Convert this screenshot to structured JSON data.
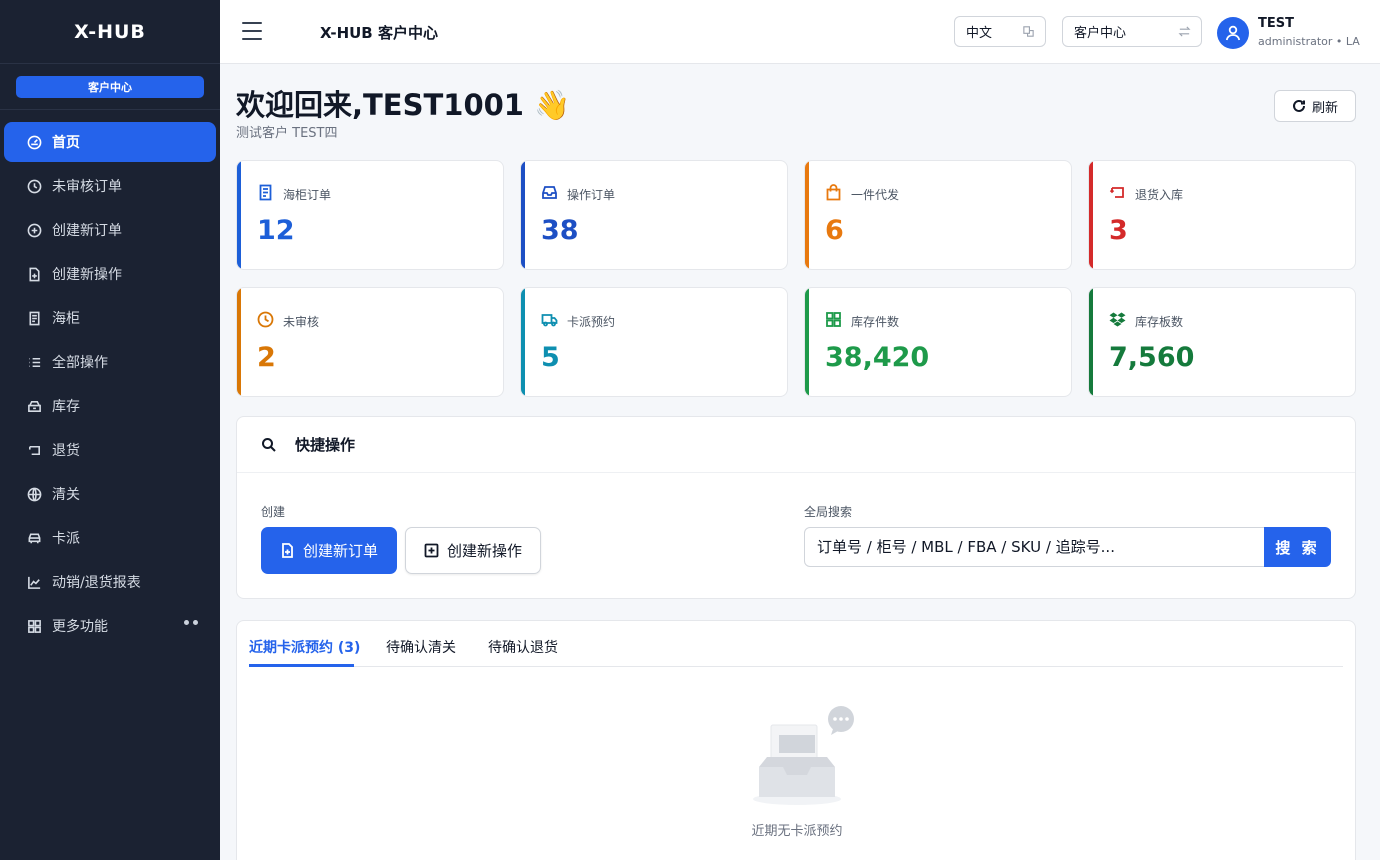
{
  "sidebar": {
    "brand": "X-HUB",
    "badge": "客户中心",
    "items": [
      {
        "label": "首页",
        "icon": "dashboard-icon"
      },
      {
        "label": "未审核订单",
        "icon": "clock-icon"
      },
      {
        "label": "创建新订单",
        "icon": "plus-circle-icon"
      },
      {
        "label": "创建新操作",
        "icon": "file-plus-icon"
      },
      {
        "label": "海柜",
        "icon": "receipt-icon"
      },
      {
        "label": "全部操作",
        "icon": "list-icon"
      },
      {
        "label": "库存",
        "icon": "box-icon"
      },
      {
        "label": "退货",
        "icon": "return-icon"
      },
      {
        "label": "清关",
        "icon": "globe-icon"
      },
      {
        "label": "卡派",
        "icon": "car-icon"
      },
      {
        "label": "动销/退货报表",
        "icon": "chart-icon"
      },
      {
        "label": "更多功能",
        "icon": "grid-icon"
      }
    ]
  },
  "topbar": {
    "title": "X-HUB 客户中心",
    "language": "中文",
    "portal": "客户中心",
    "user_name": "TEST",
    "user_role": "administrator • LA"
  },
  "header": {
    "welcome": "欢迎回来,TEST1001 👋",
    "subtitle": "测试客户 TEST四",
    "refresh_label": "刷新"
  },
  "stats": [
    {
      "label": "海柜订单",
      "value": "12",
      "color": "#1d5fd8",
      "icon": "receipt-icon"
    },
    {
      "label": "操作订单",
      "value": "38",
      "color": "#1d4fc4",
      "icon": "inbox-icon"
    },
    {
      "label": "一件代发",
      "value": "6",
      "color": "#e8790f",
      "icon": "bag-icon"
    },
    {
      "label": "退货入库",
      "value": "3",
      "color": "#d42a2a",
      "icon": "return-icon"
    },
    {
      "label": "未审核",
      "value": "2",
      "color": "#d97706",
      "icon": "clock-icon"
    },
    {
      "label": "卡派预约",
      "value": "5",
      "color": "#0e8fb0",
      "icon": "truck-icon"
    },
    {
      "label": "库存件数",
      "value": "38,420",
      "color": "#1e9a4a",
      "icon": "grid-icon"
    },
    {
      "label": "库存板数",
      "value": "7,560",
      "color": "#157a3c",
      "icon": "dropbox-icon"
    }
  ],
  "quick": {
    "title": "快捷操作",
    "create_label": "创建",
    "create_order": "创建新订单",
    "create_operation": "创建新操作",
    "search_label": "全局搜索",
    "search_placeholder": "订单号 / 柜号 / MBL / FBA / SKU / 追踪号...",
    "search_button": "搜 索"
  },
  "tabs": {
    "items": [
      "近期卡派预约 (3)",
      "待确认清关",
      "待确认退货"
    ],
    "empty_text": "近期无卡派预约"
  }
}
